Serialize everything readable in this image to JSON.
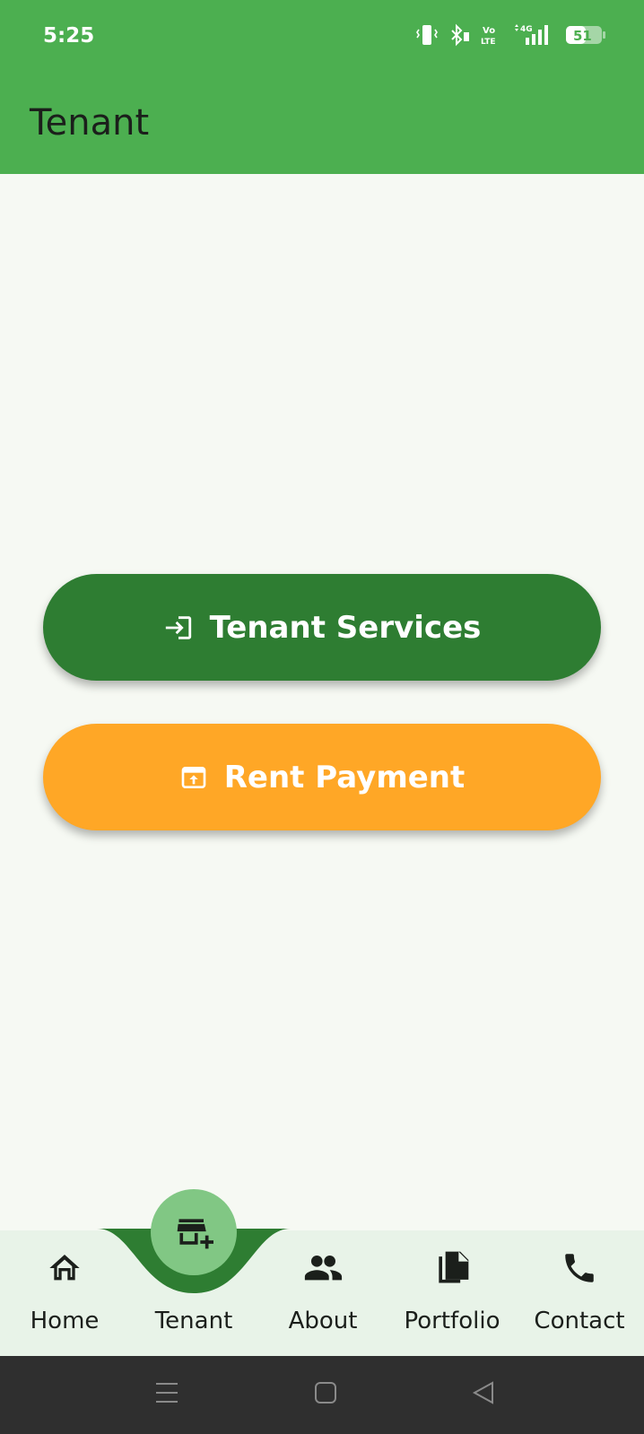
{
  "status_bar": {
    "time": "5:25",
    "battery": "51"
  },
  "app_bar": {
    "title": "Tenant"
  },
  "main": {
    "buttons": [
      {
        "label": "Tenant Services",
        "icon": "login-icon",
        "color": "#2e7d32"
      },
      {
        "label": "Rent Payment",
        "icon": "payment-icon",
        "color": "#ffa726"
      }
    ]
  },
  "bottom_nav": {
    "selected": "Tenant",
    "items": [
      {
        "label": "Home",
        "icon": "home-icon"
      },
      {
        "label": "Tenant",
        "icon": "store-add-icon"
      },
      {
        "label": "About",
        "icon": "people-icon"
      },
      {
        "label": "Portfolio",
        "icon": "files-icon"
      },
      {
        "label": "Contact",
        "icon": "phone-icon"
      }
    ]
  },
  "colors": {
    "primary": "#4caf50",
    "dark_green": "#2e7d32",
    "accent_orange": "#ffa726",
    "background": "#f6f9f3",
    "nav_background": "#e8f3e8",
    "fab": "#81c784"
  }
}
